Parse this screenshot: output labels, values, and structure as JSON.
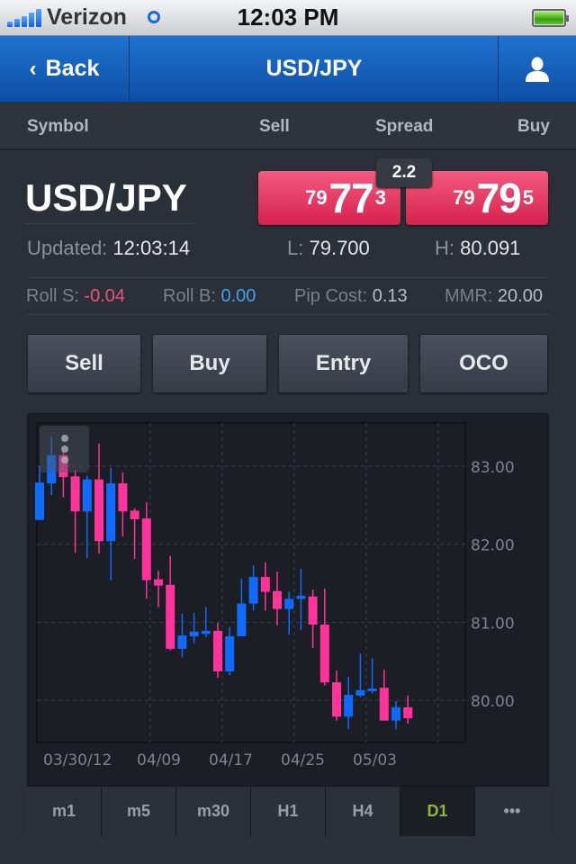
{
  "status_bar": {
    "carrier": "Verizon",
    "time": "12:03 PM"
  },
  "nav": {
    "back_label": "Back",
    "title": "USD/JPY",
    "user_icon": "user-icon"
  },
  "columns": {
    "symbol": "Symbol",
    "sell": "Sell",
    "spread": "Spread",
    "buy": "Buy"
  },
  "quote": {
    "symbol": "USD/JPY",
    "sell": {
      "prefix": "79",
      "big": "77",
      "pip": "3"
    },
    "buy": {
      "prefix": "79",
      "big": "79",
      "pip": "5"
    },
    "spread": "2.2",
    "updated_label": "Updated:",
    "updated_value": "12:03:14",
    "low_label": "L:",
    "low_value": "79.700",
    "high_label": "H:",
    "high_value": "80.091",
    "sell_color": "#e0305a"
  },
  "rollover": {
    "roll_s_label": "Roll S:",
    "roll_s_value": "-0.04",
    "roll_s_color": "#e8557a",
    "roll_b_label": "Roll B:",
    "roll_b_value": "0.00",
    "roll_b_color": "#3fa2e6",
    "pip_cost_label": "Pip Cost:",
    "pip_cost_value": "0.13",
    "mmr_label": "MMR:",
    "mmr_value": "20.00"
  },
  "actions": [
    "Sell",
    "Buy",
    "Entry",
    "OCO"
  ],
  "timeframes": {
    "items": [
      "m1",
      "m5",
      "m30",
      "H1",
      "H4",
      "D1",
      "•••"
    ],
    "active": "D1",
    "active_color": "#8fb63a"
  },
  "chart_data": {
    "type": "candlestick",
    "title": "",
    "xlabel": "",
    "ylabel": "",
    "ylim": [
      79.4,
      83.55
    ],
    "yticks": [
      "83.00",
      "82.00",
      "81.00",
      "80.00"
    ],
    "ytick_values": [
      83,
      82,
      81,
      80
    ],
    "xticks": [
      {
        "label": "03/30/12",
        "index": 0
      },
      {
        "label": "04/09",
        "index": 7
      },
      {
        "label": "04/17",
        "index": 13
      },
      {
        "label": "04/25",
        "index": 19
      },
      {
        "label": "05/03",
        "index": 25
      }
    ],
    "grid": true,
    "up_color": "#0f6bff",
    "down_color": "#ff3399",
    "candles": [
      {
        "o": 82.31,
        "h": 83.0,
        "l": 82.31,
        "c": 82.79
      },
      {
        "o": 82.78,
        "h": 83.38,
        "l": 82.63,
        "c": 83.14
      },
      {
        "o": 83.14,
        "h": 83.21,
        "l": 82.6,
        "c": 82.86
      },
      {
        "o": 82.87,
        "h": 82.95,
        "l": 81.89,
        "c": 82.42
      },
      {
        "o": 82.42,
        "h": 82.88,
        "l": 81.82,
        "c": 82.83
      },
      {
        "o": 82.83,
        "h": 83.29,
        "l": 81.88,
        "c": 82.04
      },
      {
        "o": 82.04,
        "h": 82.98,
        "l": 81.54,
        "c": 82.78
      },
      {
        "o": 82.78,
        "h": 82.92,
        "l": 82.1,
        "c": 82.42
      },
      {
        "o": 82.43,
        "h": 82.46,
        "l": 81.81,
        "c": 82.32
      },
      {
        "o": 82.33,
        "h": 82.54,
        "l": 81.3,
        "c": 81.54
      },
      {
        "o": 81.55,
        "h": 81.66,
        "l": 81.19,
        "c": 81.47
      },
      {
        "o": 81.48,
        "h": 81.85,
        "l": 80.64,
        "c": 80.66
      },
      {
        "o": 80.66,
        "h": 81.11,
        "l": 80.55,
        "c": 80.83
      },
      {
        "o": 80.82,
        "h": 81.12,
        "l": 80.73,
        "c": 80.88
      },
      {
        "o": 80.85,
        "h": 81.19,
        "l": 80.81,
        "c": 80.89
      },
      {
        "o": 80.89,
        "h": 80.99,
        "l": 80.29,
        "c": 80.37
      },
      {
        "o": 80.37,
        "h": 80.94,
        "l": 80.32,
        "c": 80.82
      },
      {
        "o": 80.82,
        "h": 81.56,
        "l": 80.82,
        "c": 81.24
      },
      {
        "o": 81.24,
        "h": 81.73,
        "l": 81.15,
        "c": 81.58
      },
      {
        "o": 81.58,
        "h": 81.77,
        "l": 81.15,
        "c": 81.39
      },
      {
        "o": 81.4,
        "h": 81.65,
        "l": 80.96,
        "c": 81.17
      },
      {
        "o": 81.17,
        "h": 81.39,
        "l": 80.84,
        "c": 81.3
      },
      {
        "o": 81.3,
        "h": 81.69,
        "l": 80.9,
        "c": 81.34
      },
      {
        "o": 81.33,
        "h": 81.42,
        "l": 80.67,
        "c": 80.97
      },
      {
        "o": 80.97,
        "h": 81.43,
        "l": 80.19,
        "c": 80.23
      },
      {
        "o": 80.23,
        "h": 80.38,
        "l": 79.74,
        "c": 79.79
      },
      {
        "o": 79.79,
        "h": 80.3,
        "l": 79.63,
        "c": 80.07
      },
      {
        "o": 80.06,
        "h": 80.6,
        "l": 80.04,
        "c": 80.13
      },
      {
        "o": 80.12,
        "h": 80.54,
        "l": 80.09,
        "c": 80.15
      },
      {
        "o": 80.16,
        "h": 80.39,
        "l": 79.74,
        "c": 79.74
      },
      {
        "o": 79.74,
        "h": 79.99,
        "l": 79.63,
        "c": 79.91
      },
      {
        "o": 79.91,
        "h": 80.06,
        "l": 79.7,
        "c": 79.77
      }
    ]
  }
}
